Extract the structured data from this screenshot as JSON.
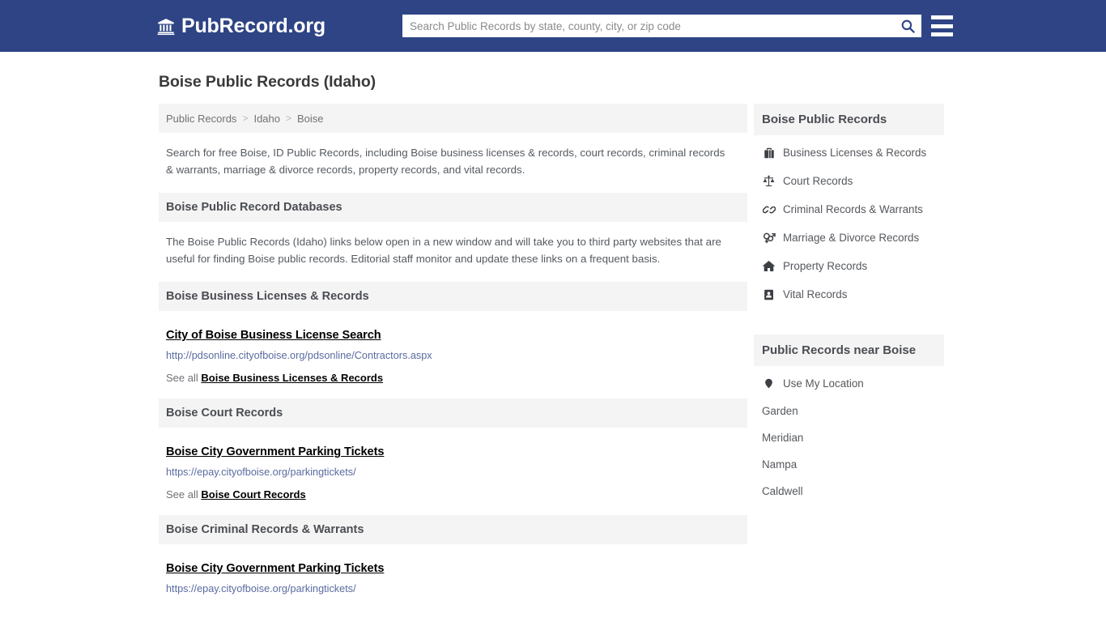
{
  "header": {
    "brand_name": "PubRecord.org",
    "brand_icon": "university-icon",
    "search_placeholder": "Search Public Records by state, county, city, or zip code",
    "search_value": "",
    "search_icon": "search-icon",
    "menu_icon": "hamburger-menu-icon"
  },
  "page": {
    "title": "Boise Public Records (Idaho)"
  },
  "breadcrumb": {
    "items": [
      {
        "label": "Public Records"
      },
      {
        "label": "Idaho"
      },
      {
        "label": "Boise"
      }
    ],
    "separator": ">"
  },
  "intro": {
    "text": "Search for free Boise, ID Public Records, including Boise business licenses & records, court records, criminal records & warrants, marriage & divorce records, property records, and vital records."
  },
  "databases": {
    "heading": "Boise Public Record Databases",
    "text": "The Boise Public Records (Idaho) links below open in a new window and will take you to third party websites that are useful for finding Boise public records. Editorial staff monitor and update these links on a frequent basis."
  },
  "sections": [
    {
      "heading": "Boise Business Licenses & Records",
      "entry_title": "City of Boise Business License Search",
      "entry_url": "http://pdsonline.cityofboise.org/pdsonline/Contractors.aspx",
      "see_all_prefix": "See all",
      "see_all_link": "Boise Business Licenses & Records"
    },
    {
      "heading": "Boise Court Records",
      "entry_title": "Boise City Government Parking Tickets",
      "entry_url": "https://epay.cityofboise.org/parkingtickets/",
      "see_all_prefix": "See all",
      "see_all_link": "Boise Court Records"
    },
    {
      "heading": "Boise Criminal Records & Warrants",
      "entry_title": "Boise City Government Parking Tickets",
      "entry_url": "https://epay.cityofboise.org/parkingtickets/",
      "see_all_prefix": "",
      "see_all_link": ""
    }
  ],
  "sidebar": {
    "records": {
      "heading": "Boise Public Records",
      "items": [
        {
          "label": "Business Licenses & Records",
          "icon": "briefcase-icon"
        },
        {
          "label": "Court Records",
          "icon": "scales-balance-icon"
        },
        {
          "label": "Criminal Records & Warrants",
          "icon": "chain-link-icon"
        },
        {
          "label": "Marriage & Divorce Records",
          "icon": "venus-mars-icon"
        },
        {
          "label": "Property Records",
          "icon": "home-icon"
        },
        {
          "label": "Vital Records",
          "icon": "id-card-icon"
        }
      ]
    },
    "nearby": {
      "heading": "Public Records near Boise",
      "items": [
        {
          "label": "Use My Location",
          "icon": "map-pin-icon"
        },
        {
          "label": "Garden",
          "icon": ""
        },
        {
          "label": "Meridian",
          "icon": ""
        },
        {
          "label": "Nampa",
          "icon": ""
        },
        {
          "label": "Caldwell",
          "icon": ""
        }
      ]
    }
  },
  "colors": {
    "header_blue": "#2e4485",
    "panel_gray": "#f4f4f4",
    "url_blue": "#5a6ba0",
    "text_gray": "#55585d"
  }
}
